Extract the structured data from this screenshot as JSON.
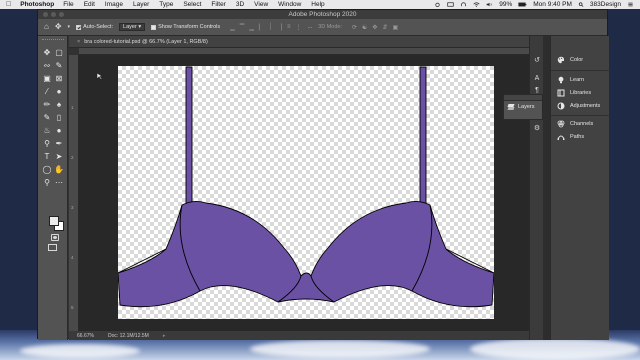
{
  "menubar": {
    "apple": "",
    "app_name": "Photoshop",
    "items": [
      "File",
      "Edit",
      "Image",
      "Layer",
      "Type",
      "Select",
      "Filter",
      "3D",
      "View",
      "Window",
      "Help"
    ],
    "battery": "99%",
    "clock": "Mon 9:40 PM",
    "user": "383Design"
  },
  "window": {
    "title": "Adobe Photoshop 2020"
  },
  "options_bar": {
    "auto_select_label": "Auto-Select:",
    "auto_select_checked": true,
    "auto_select_target": "Layer",
    "transform_controls_label": "Show Transform Controls",
    "transform_controls_checked": false,
    "mode_3d_label": "3D Mode:",
    "more": "..."
  },
  "document": {
    "tab_label": "bra colored-tutorial.psd @ 66.7% (Layer 1, RGB/8)",
    "tab_close": "×",
    "zoom": "66.67%",
    "doc_size": "Doc: 12.1M/12.5M",
    "fill_color": "#6a51a3",
    "ruler_labels": [
      "1",
      "2",
      "3",
      "4",
      "5"
    ]
  },
  "panels": {
    "layers_flyout": "Layers",
    "items": [
      {
        "label": "Color",
        "icon": "palette-icon"
      },
      {
        "label": "Learn",
        "icon": "lightbulb-icon"
      },
      {
        "label": "Libraries",
        "icon": "libraries-icon"
      },
      {
        "label": "Adjustments",
        "icon": "adjustments-icon"
      },
      {
        "label": "Channels",
        "icon": "channels-icon"
      },
      {
        "label": "Paths",
        "icon": "paths-icon"
      }
    ]
  }
}
